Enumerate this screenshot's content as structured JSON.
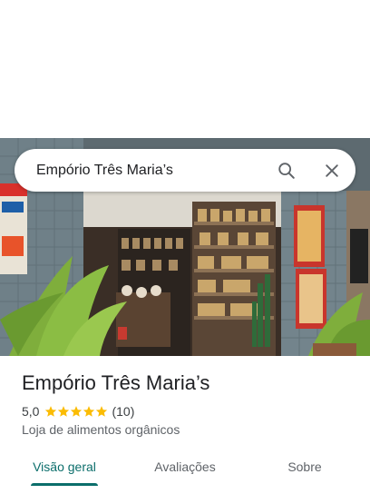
{
  "search": {
    "query": "Empório Três Maria’s"
  },
  "place": {
    "name": "Empório Três Maria’s",
    "rating": "5,0",
    "stars": 5,
    "review_count": "(10)",
    "category": "Loja de alimentos orgânicos"
  },
  "tabs": [
    {
      "label": "Visão geral",
      "active": true
    },
    {
      "label": "Avaliações",
      "active": false
    },
    {
      "label": "Sobre",
      "active": false
    }
  ],
  "colors": {
    "accent": "#0b6e6b",
    "star": "#fbbc04"
  },
  "icons": {
    "search": "search-icon",
    "close": "close-icon",
    "star": "star-icon"
  }
}
